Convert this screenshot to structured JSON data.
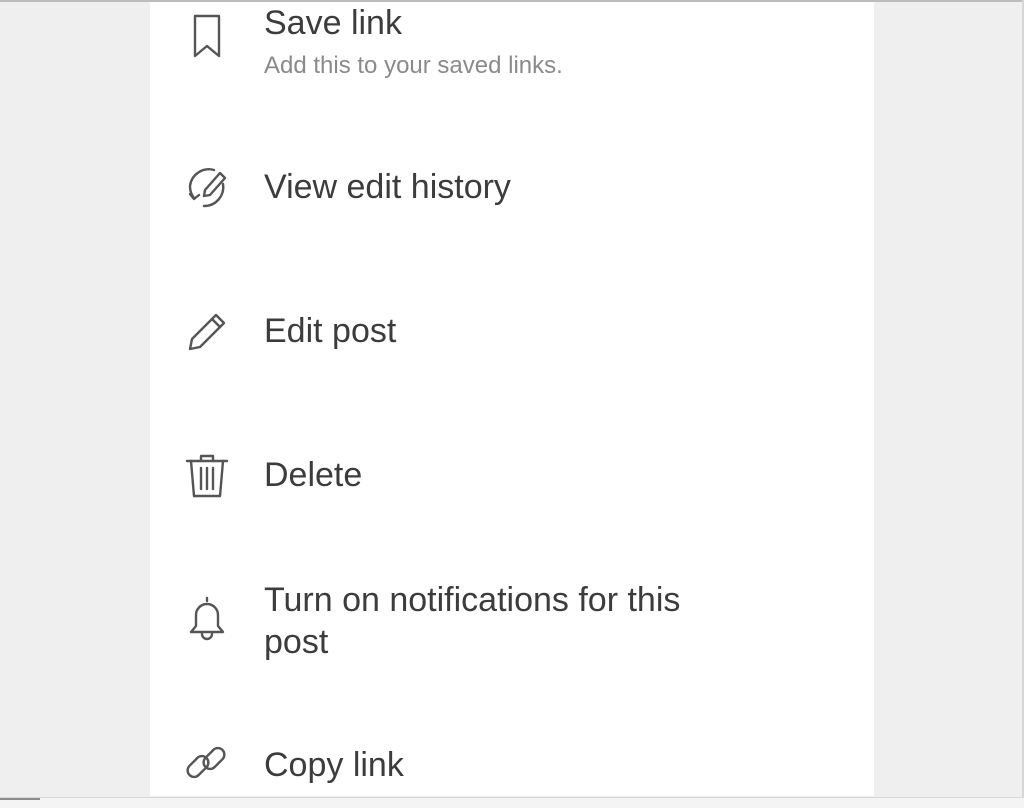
{
  "menu": {
    "items": [
      {
        "id": "save-link",
        "label": "Save link",
        "sublabel": "Add this to your saved links.",
        "icon": "bookmark-icon"
      },
      {
        "id": "view-edit-history",
        "label": "View edit history",
        "icon": "edit-history-icon"
      },
      {
        "id": "edit-post",
        "label": "Edit post",
        "icon": "pencil-icon"
      },
      {
        "id": "delete",
        "label": "Delete",
        "icon": "trash-icon"
      },
      {
        "id": "turn-on-notifications",
        "label": "Turn on notifications for this post",
        "icon": "bell-icon"
      },
      {
        "id": "copy-link",
        "label": "Copy link",
        "icon": "link-icon"
      }
    ]
  },
  "colors": {
    "background": "#efefef",
    "panel": "#ffffff",
    "text": "#3c3c3c",
    "subtext": "#8a8a8a",
    "icon": "#555555"
  }
}
